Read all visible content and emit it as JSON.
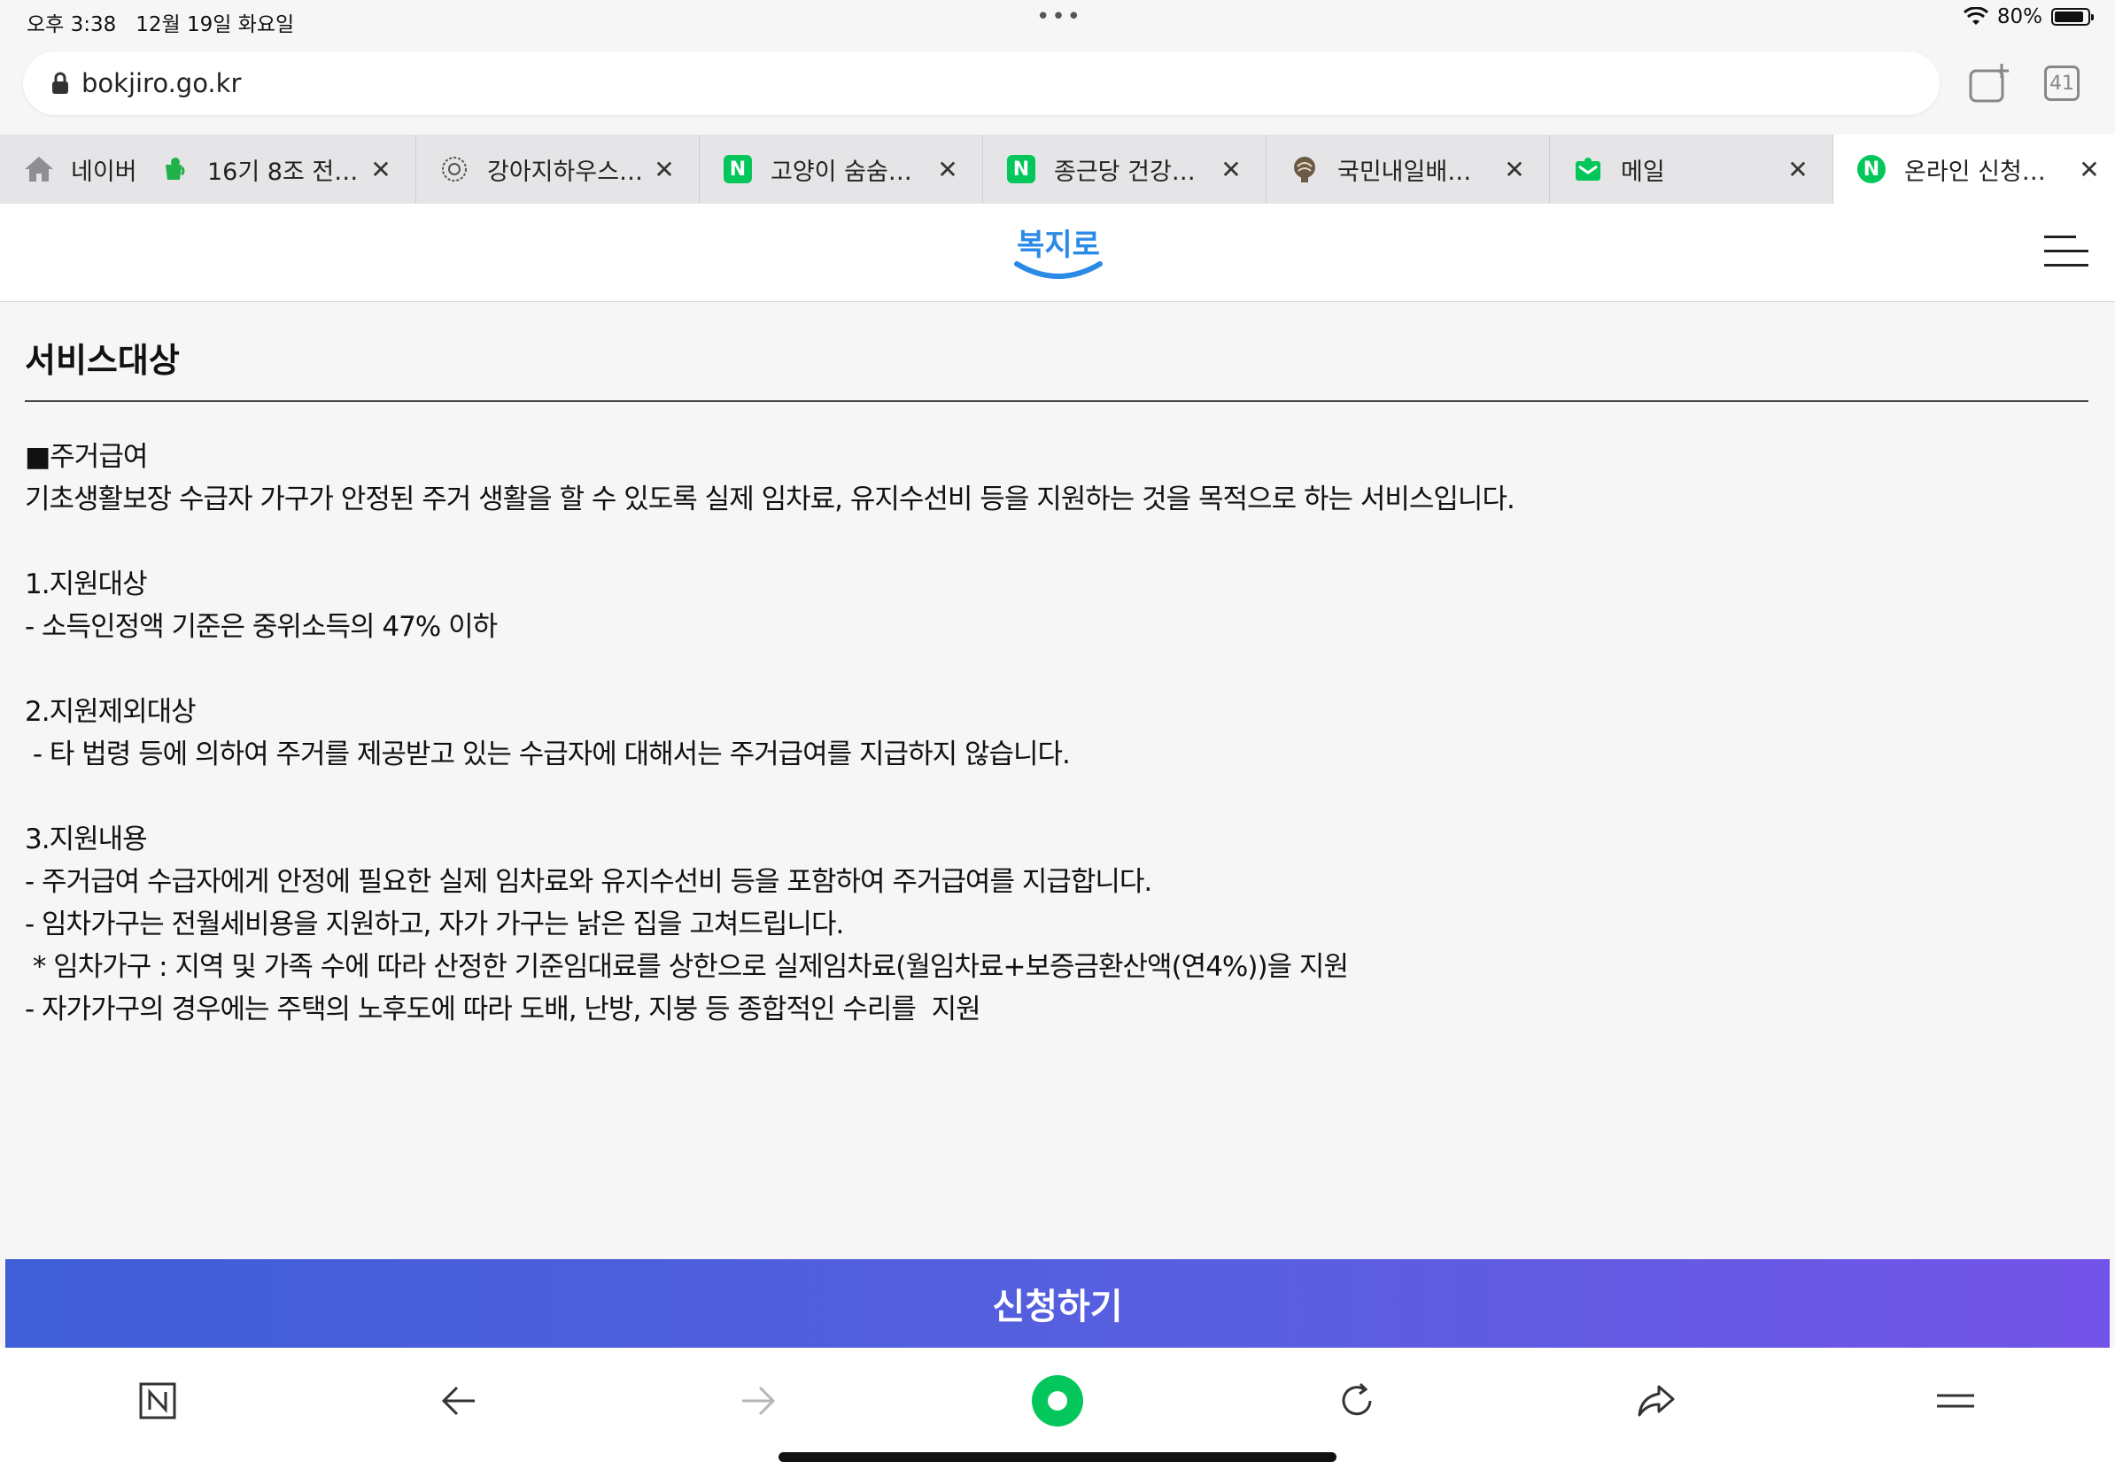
{
  "status_bar": {
    "time": "오후 3:38",
    "date": "12월 19일 화요일",
    "battery": "80%",
    "battery_level": 0.8
  },
  "address_bar": {
    "url": "bokjiro.go.kr",
    "tab_count": "41"
  },
  "tabs": {
    "home_label": "네이버",
    "items": [
      {
        "label": "16기 8조 전…",
        "icon": "green-cup-icon"
      },
      {
        "label": "강아지하우스…",
        "icon": "dog-house-logo-icon"
      },
      {
        "label": "고양이 숨숨…",
        "icon": "naver-n-icon"
      },
      {
        "label": "종근당 건강…",
        "icon": "naver-n-icon"
      },
      {
        "label": "국민내일배…",
        "icon": "brain-icon"
      },
      {
        "label": "메일",
        "icon": "mail-icon"
      },
      {
        "label": "온라인 신청…",
        "icon": "naver-n-icon"
      }
    ]
  },
  "site": {
    "logo_text": "복지로"
  },
  "content": {
    "section_title": "서비스대상",
    "lines": [
      "■주거급여",
      "기초생활보장 수급자 가구가 안정된 주거 생활을 할 수 있도록 실제 임차료, 유지수선비 등을 지원하는 것을 목적으로 하는 서비스입니다.",
      "",
      "1.지원대상",
      "- 소득인정액 기준은 중위소득의 47% 이하",
      "",
      "2.지원제외대상",
      " - 타 법령 등에 의하여 주거를 제공받고 있는 수급자에 대해서는 주거급여를 지급하지 않습니다.",
      "",
      "3.지원내용",
      "- 주거급여 수급자에게 안정에 필요한 실제 임차료와 유지수선비 등을 포함하여 주거급여를 지급합니다.",
      "- 임차가구는 전월세비용을 지원하고, 자가 가구는 낡은 집을 고쳐드립니다.",
      " * 임차가구 : 지역 및 가족 수에 따라 산정한 기준임대료를 상한으로 실제임차료(월임차료+보증금환산액(연4%))을 지원",
      "- 자가가구의 경우에는 주택의 노후도에 따라 도배, 난방, 지붕 등 종합적인 수리를  지원"
    ]
  },
  "apply_button": "신청하기",
  "colors": {
    "naver_green": "#03c75a",
    "apply_gradient_start": "#3f5ed8",
    "apply_gradient_end": "#7354e8",
    "logo_blue": "#2b8ae6"
  }
}
